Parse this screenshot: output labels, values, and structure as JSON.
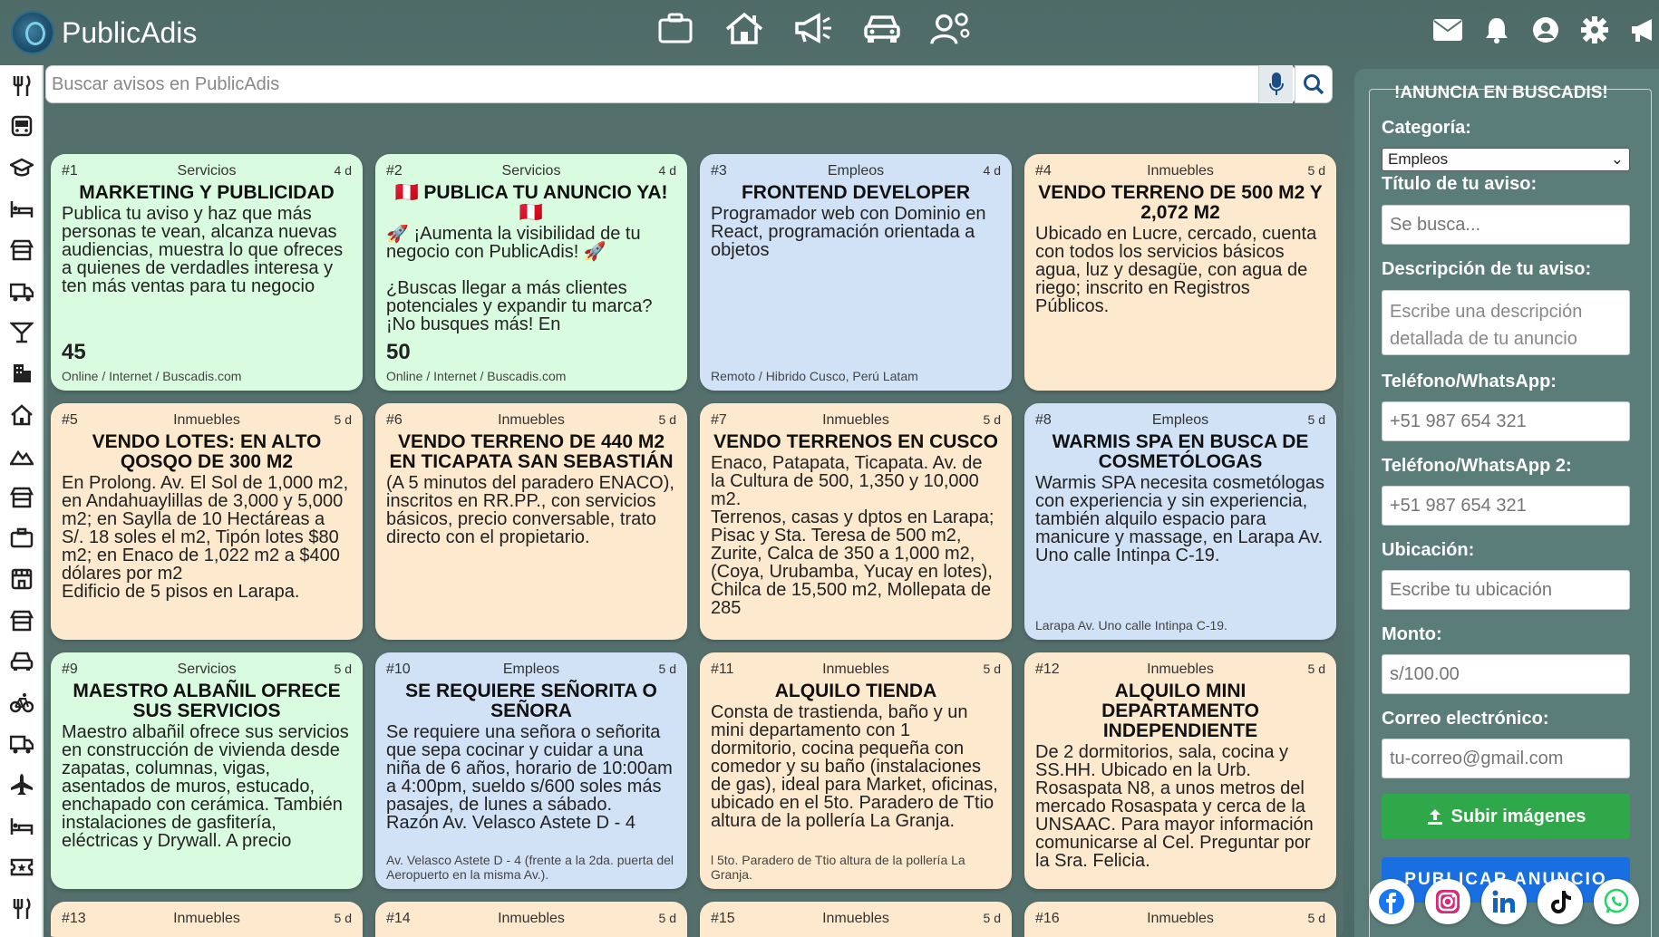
{
  "app": {
    "name": "PublicAdis"
  },
  "search": {
    "placeholder": "Buscar avisos en PublicAdis"
  },
  "topnav": [
    {
      "icon": "briefcase-icon"
    },
    {
      "icon": "house-icon"
    },
    {
      "icon": "megaphone-icon"
    },
    {
      "icon": "car-icon"
    },
    {
      "icon": "user-gears-icon"
    }
  ],
  "header_actions": [
    {
      "icon": "envelope-icon"
    },
    {
      "icon": "bell-icon"
    },
    {
      "icon": "user-circle-icon"
    },
    {
      "icon": "gear-icon"
    },
    {
      "icon": "bullhorn-icon"
    }
  ],
  "sidebar": [
    "utensils-icon",
    "bus-icon",
    "graduation-cap-icon",
    "bed-icon",
    "store-icon",
    "truck-icon",
    "cocktail-icon",
    "building-icon",
    "house-icon",
    "mountain-icon",
    "store-icon",
    "briefcase-icon",
    "shop-icon",
    "store-icon",
    "car-icon",
    "bicycle-icon",
    "truck-icon",
    "plane-icon",
    "bed-icon",
    "ticket-icon",
    "utensils-icon"
  ],
  "cards": [
    {
      "num": "#1",
      "cat": "Servicios",
      "age": "4 d",
      "color": "green",
      "title": "MARKETING Y PUBLICIDAD",
      "desc": "Publica tu aviso y haz que más personas te vean, alcanza nuevas audiencias, muestra lo que ofreces a quienes de verdadles interesa y ten más ventas para tu negocio",
      "price": "45",
      "loc": "Online / Internet / Buscadis.com"
    },
    {
      "num": "#2",
      "cat": "Servicios",
      "age": "4 d",
      "color": "green",
      "title": "🇵🇪 PUBLICA TU ANUNCIO YA! 🇵🇪",
      "desc": "🚀 ¡Aumenta la visibilidad de tu negocio con PublicAdis! 🚀\n\n¿Buscas llegar a más clientes potenciales y expandir tu marca? ¡No busques más! En",
      "price": "50",
      "loc": "Online / Internet / Buscadis.com"
    },
    {
      "num": "#3",
      "cat": "Empleos",
      "age": "4 d",
      "color": "blue",
      "title": "FRONTEND DEVELOPER",
      "desc": "Programador web con Dominio en React, programación orientada a objetos",
      "price": "",
      "loc": "Remoto / Hibrido Cusco, Perú Latam"
    },
    {
      "num": "#4",
      "cat": "Inmuebles",
      "age": "5 d",
      "color": "beige",
      "title": "VENDO TERRENO DE 500 M2 Y 2,072 M2",
      "desc": "Ubicado en Lucre, cercado, cuenta con todos los servicios básicos agua, luz y desagüe, con agua de riego; inscrito en Registros Públicos.",
      "price": "",
      "loc": ""
    },
    {
      "num": "#5",
      "cat": "Inmuebles",
      "age": "5 d",
      "color": "beige",
      "title": "VENDO LOTES: EN ALTO QOSQO DE 300 M2",
      "desc": "En Prolong. Av. El Sol de 1,000 m2, en Andahuaylillas de 3,000 y 5,000 m2; en Saylla de 10 Hectáreas a S/. 18 soles el m2, Tipón lotes $80 m2; en Enaco de 1,022 m2 a $400 dólares por m2\nEdificio de 5 pisos en Larapa.",
      "price": "",
      "loc": ""
    },
    {
      "num": "#6",
      "cat": "Inmuebles",
      "age": "5 d",
      "color": "beige",
      "title": "VENDO TERRENO DE 440 M2 EN TICAPATA SAN SEBASTIÁN",
      "desc": "(A 5 minutos del paradero ENACO), inscritos en RR.PP., con servicios básicos, precio conversable, trato directo con el propietario.",
      "price": "",
      "loc": ""
    },
    {
      "num": "#7",
      "cat": "Inmuebles",
      "age": "5 d",
      "color": "beige",
      "title": "VENDO TERRENOS EN CUSCO",
      "desc": "Enaco, Patapata, Ticapata. Av. de la Cultura de 500, 1,350 y 10,000 m2.\nTerrenos, casas y dptos en Larapa; Pisac y Sta. Teresa de 500 m2, Zurite, Calca de 350 a 1,000 m2, (Coya, Urubamba, Yucay en lotes), Chilca de 15,500 m2, Mollepata de 285",
      "price": "",
      "loc": ""
    },
    {
      "num": "#8",
      "cat": "Empleos",
      "age": "5 d",
      "color": "blue",
      "title": "WARMIS SPA EN BUSCA DE COSMETÓLOGAS",
      "desc": "Warmis SPA necesita cosmetólogas con experiencia y sin experiencia, también alquilo espacio para manicure y massage, en Larapa Av. Uno calle Intinpa C-19.",
      "price": "",
      "loc": "Larapa Av. Uno calle Intinpa C-19."
    },
    {
      "num": "#9",
      "cat": "Servicios",
      "age": "5 d",
      "color": "green",
      "title": "MAESTRO ALBAÑIL OFRECE SUS SERVICIOS",
      "desc": "Maestro albañil ofrece sus servicios en construcción de vivienda desde zapatas, columnas, vigas, asentados de muros, estucado, enchapado con cerámica. También instalaciones de gasfitería, eléctricas y Drywall. A precio",
      "price": "",
      "loc": ""
    },
    {
      "num": "#10",
      "cat": "Empleos",
      "age": "5 d",
      "color": "blue",
      "title": "SE REQUIERE SEÑORITA O SEÑORA",
      "desc": "Se requiere una señora o señorita que sepa cocinar y cuidar a una niña de 6 años, horario de 10:00am a 4:00pm, sueldo s/600 soles más pasajes, de lunes a sábado.\nRazón Av. Velasco Astete D - 4",
      "price": "",
      "loc": "Av. Velasco Astete D - 4 (frente a la 2da. puerta del Aeropuerto en la misma Av.)."
    },
    {
      "num": "#11",
      "cat": "Inmuebles",
      "age": "5 d",
      "color": "beige",
      "title": "ALQUILO TIENDA",
      "desc": "Consta de trastienda, baño y un mini departamento con 1 dormitorio, cocina pequeña con comedor y su baño (instalaciones de gas), ideal para Market, oficinas, ubicado en el 5to. Paradero de Ttio altura de la pollería La Granja.",
      "price": "",
      "loc": "l 5to. Paradero de Ttio altura de la pollería La Granja."
    },
    {
      "num": "#12",
      "cat": "Inmuebles",
      "age": "5 d",
      "color": "beige",
      "title": "ALQUILO MINI DEPARTAMENTO INDEPENDIENTE",
      "desc": "De 2 dormitorios, sala, cocina y SS.HH. Ubicado en la Urb. Rosaspata N8, a unos metros del mercado Rosaspata y cerca de la UNSAAC. Para mayor información comunicarse al Cel. Preguntar por la Sra. Felicia.",
      "price": "",
      "loc": ""
    },
    {
      "num": "#13",
      "cat": "Inmuebles",
      "age": "5 d",
      "color": "beige",
      "title": "",
      "desc": "",
      "price": "",
      "loc": ""
    },
    {
      "num": "#14",
      "cat": "Inmuebles",
      "age": "5 d",
      "color": "beige",
      "title": "",
      "desc": "",
      "price": "",
      "loc": ""
    },
    {
      "num": "#15",
      "cat": "Inmuebles",
      "age": "5 d",
      "color": "beige",
      "title": "",
      "desc": "",
      "price": "",
      "loc": ""
    },
    {
      "num": "#16",
      "cat": "Inmuebles",
      "age": "5 d",
      "color": "beige",
      "title": "",
      "desc": "",
      "price": "",
      "loc": ""
    }
  ],
  "form": {
    "title": "!ANUNCIA EN BUSCADIS!",
    "category_label": "Categoría:",
    "category_value": "Empleos",
    "ad_title_label": "Título de tu aviso:",
    "ad_title_placeholder": "Se busca...",
    "desc_label": "Descripción de tu aviso:",
    "desc_placeholder": "Escribe una descripción detallada de tu anuncio",
    "phone_label": "Teléfono/WhatsApp:",
    "phone_placeholder": "+51 987 654 321",
    "phone2_label": "Teléfono/WhatsApp 2:",
    "phone2_placeholder": "+51 987 654 321",
    "location_label": "Ubicación:",
    "location_placeholder": "Escribe tu ubicación",
    "amount_label": "Monto:",
    "amount_placeholder": "s/100.00",
    "email_label": "Correo electrónico:",
    "email_placeholder": "tu-correo@gmail.com",
    "upload_label": "Subir imágenes",
    "publish_label": "PUBLICAR ANUNCIO"
  },
  "socials": [
    "facebook-icon",
    "instagram-icon",
    "linkedin-icon",
    "tiktok-icon",
    "whatsapp-icon"
  ],
  "colors": {
    "green": "#d9fbe0",
    "blue": "#d2e2f6",
    "beige": "#fde9cd",
    "upload": "#2fa84a",
    "publish": "#1a6fe0"
  }
}
